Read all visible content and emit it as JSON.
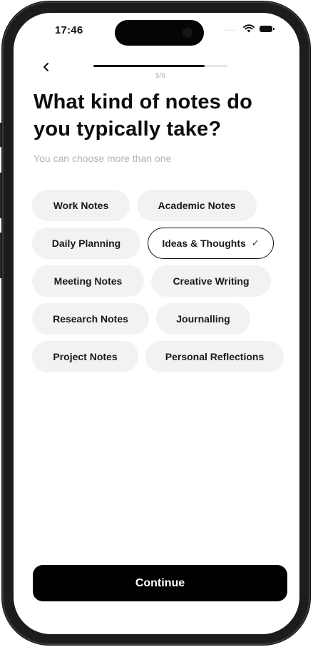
{
  "status_bar": {
    "time": "17:46",
    "signal_dots": "...."
  },
  "header": {
    "back_icon": "chevron-left-icon",
    "progress_fraction": 0.83,
    "step_label": "5/6"
  },
  "question": {
    "title": "What kind of notes do you typically take?",
    "subtitle": "You can choose more than one"
  },
  "options": [
    {
      "label": "Work Notes",
      "selected": false
    },
    {
      "label": "Academic Notes",
      "selected": false
    },
    {
      "label": "Daily Planning",
      "selected": false
    },
    {
      "label": "Ideas & Thoughts",
      "selected": true,
      "check_mark": "✓"
    },
    {
      "label": "Meeting Notes",
      "selected": false
    },
    {
      "label": "Creative Writing",
      "selected": false
    },
    {
      "label": "Research Notes",
      "selected": false
    },
    {
      "label": "Journalling",
      "selected": false
    },
    {
      "label": "Project Notes",
      "selected": false
    },
    {
      "label": "Personal Reflections",
      "selected": false
    }
  ],
  "footer": {
    "continue_label": "Continue"
  },
  "colors": {
    "primary": "#000000",
    "chip_bg": "#f2f2f4",
    "muted_text": "#b3b3b3"
  }
}
